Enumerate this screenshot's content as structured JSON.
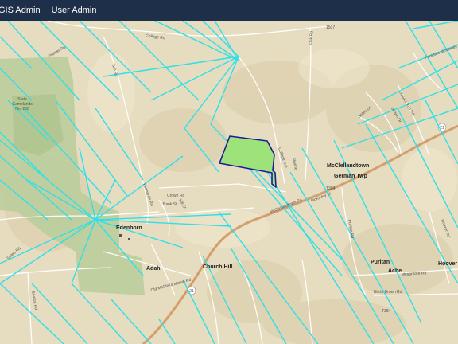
{
  "nav": {
    "items": [
      {
        "label": "GIS Admin"
      },
      {
        "label": "User Admin"
      }
    ]
  },
  "map": {
    "colors": {
      "terrain": "#e6dcc0",
      "state_forest": "#b8cc9a",
      "highway": "#d9a878",
      "roads": "#ffffff",
      "grid_lines": "#2ee0e8",
      "parcel_fill": "#9ee27a",
      "parcel_outline": "#1a1a9a",
      "header": "#1e2f4a"
    },
    "places": [
      {
        "name": "McClellandtown"
      },
      {
        "name": "German Twp"
      },
      {
        "name": "Edenborn"
      },
      {
        "name": "Adah"
      },
      {
        "name": "Church Hill"
      },
      {
        "name": "Puritan"
      },
      {
        "name": "Ache"
      },
      {
        "name": "Hoover"
      }
    ],
    "area_labels": [
      {
        "name": "State"
      },
      {
        "name": "Gamelands"
      },
      {
        "name": "No. 238"
      }
    ],
    "road_labels": [
      {
        "name": "College Rd"
      },
      {
        "name": "Palmer Rd"
      },
      {
        "name": "Bell Rd"
      },
      {
        "name": "College Ave"
      },
      {
        "name": "McClellandtown Rd"
      },
      {
        "name": "McKinley St"
      },
      {
        "name": "Puritan Rd"
      },
      {
        "name": "Mesamore Rd"
      },
      {
        "name": "Oak Rd"
      },
      {
        "name": "Gates Rd"
      },
      {
        "name": "Seaton Rd"
      },
      {
        "name": "Crown Rd"
      },
      {
        "name": "Bank St"
      },
      {
        "name": "Hill St"
      },
      {
        "name": "Old McClellandtown Rd"
      },
      {
        "name": "Fairbanks Rd"
      },
      {
        "name": "Rowes Run Rd"
      },
      {
        "name": "Bates Dr"
      },
      {
        "name": "Brown Dr"
      },
      {
        "name": "Footdale McKinney Rd"
      },
      {
        "name": "Hoover Rd"
      },
      {
        "name": "North Brown Rd"
      },
      {
        "name": "Skyline"
      }
    ],
    "route_shields": [
      {
        "label": "21"
      },
      {
        "label": "21"
      }
    ],
    "route_numbers": [
      {
        "label": "1507"
      },
      {
        "label": "T384"
      },
      {
        "label": "T384"
      }
    ]
  }
}
